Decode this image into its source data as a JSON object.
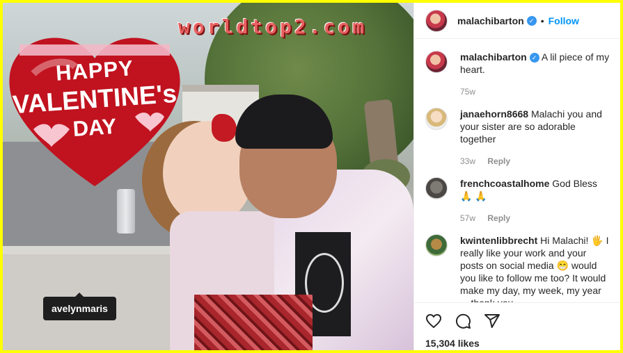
{
  "photo": {
    "watermark": "worldtop2.com",
    "balloon": {
      "line1": "HAPPY",
      "line2": "VALENTINE's",
      "line3": "DAY"
    },
    "user_tag": "avelynmaris"
  },
  "post_header": {
    "username": "malachibarton",
    "separator": "•",
    "follow_label": "Follow"
  },
  "caption": {
    "username": "malachibarton",
    "text": "A lil piece of my heart.",
    "time": "75w"
  },
  "comments": [
    {
      "username": "janaehorn8668",
      "text": "Malachi you and your sister are so adorable together",
      "time": "33w",
      "reply_label": "Reply"
    },
    {
      "username": "frenchcoastalhome",
      "text": "God Bless 🙏 🙏",
      "time": "57w",
      "reply_label": "Reply"
    },
    {
      "username": "kwintenlibbrecht",
      "text": "Hi Malachi! 🖐 I really like your work and your posts on social media 😁 would you like to follow me too? It would make my day, my week, my year ... thank you",
      "time": "",
      "reply_label": ""
    }
  ],
  "actions": {
    "icons": [
      "heart-icon",
      "comment-icon",
      "share-icon"
    ],
    "likes": "15,304 likes"
  },
  "colors": {
    "frame": "#ffff00",
    "accent": "#0095f6",
    "verified": "#3897f0"
  }
}
